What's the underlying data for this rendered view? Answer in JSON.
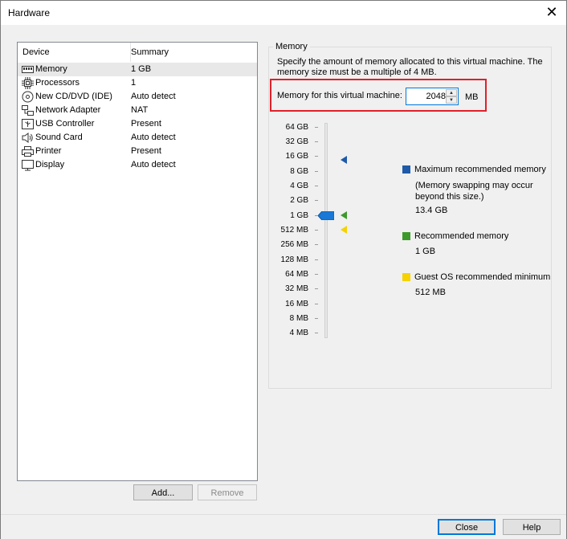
{
  "window": {
    "title": "Hardware"
  },
  "list": {
    "headers": {
      "device": "Device",
      "summary": "Summary"
    },
    "rows": [
      {
        "name": "Memory",
        "summary": "1 GB",
        "icon": "memory-icon"
      },
      {
        "name": "Processors",
        "summary": "1",
        "icon": "processor-icon"
      },
      {
        "name": "New CD/DVD (IDE)",
        "summary": "Auto detect",
        "icon": "cd-dvd-icon"
      },
      {
        "name": "Network Adapter",
        "summary": "NAT",
        "icon": "network-adapter-icon"
      },
      {
        "name": "USB Controller",
        "summary": "Present",
        "icon": "usb-controller-icon"
      },
      {
        "name": "Sound Card",
        "summary": "Auto detect",
        "icon": "sound-card-icon"
      },
      {
        "name": "Printer",
        "summary": "Present",
        "icon": "printer-icon"
      },
      {
        "name": "Display",
        "summary": "Auto detect",
        "icon": "display-icon"
      }
    ],
    "selected": "Memory"
  },
  "buttons": {
    "add": "Add...",
    "remove": "Remove",
    "close": "Close",
    "help": "Help"
  },
  "memory": {
    "group_title": "Memory",
    "description": "Specify the amount of memory allocated to this virtual machine. The memory size must be a multiple of 4 MB.",
    "field_label": "Memory for this virtual machine:",
    "value": "2048",
    "unit": "MB",
    "scale": [
      "64 GB",
      "32 GB",
      "16 GB",
      "8 GB",
      "4 GB",
      "2 GB",
      "1 GB",
      "512 MB",
      "256 MB",
      "128 MB",
      "64 MB",
      "32 MB",
      "16 MB",
      "8 MB",
      "4 MB"
    ],
    "slider_level": "1 GB",
    "legend": {
      "max": {
        "label": "Maximum recommended memory",
        "note": "(Memory swapping may occur beyond this size.)",
        "value": "13.4 GB",
        "color": "#1e5aa8"
      },
      "rec": {
        "label": "Recommended memory",
        "value": "1 GB",
        "color": "#3c9a2a"
      },
      "min": {
        "label": "Guest OS recommended minimum",
        "value": "512 MB",
        "color": "#f5d200"
      }
    },
    "highlight_color": "#e0202a"
  }
}
